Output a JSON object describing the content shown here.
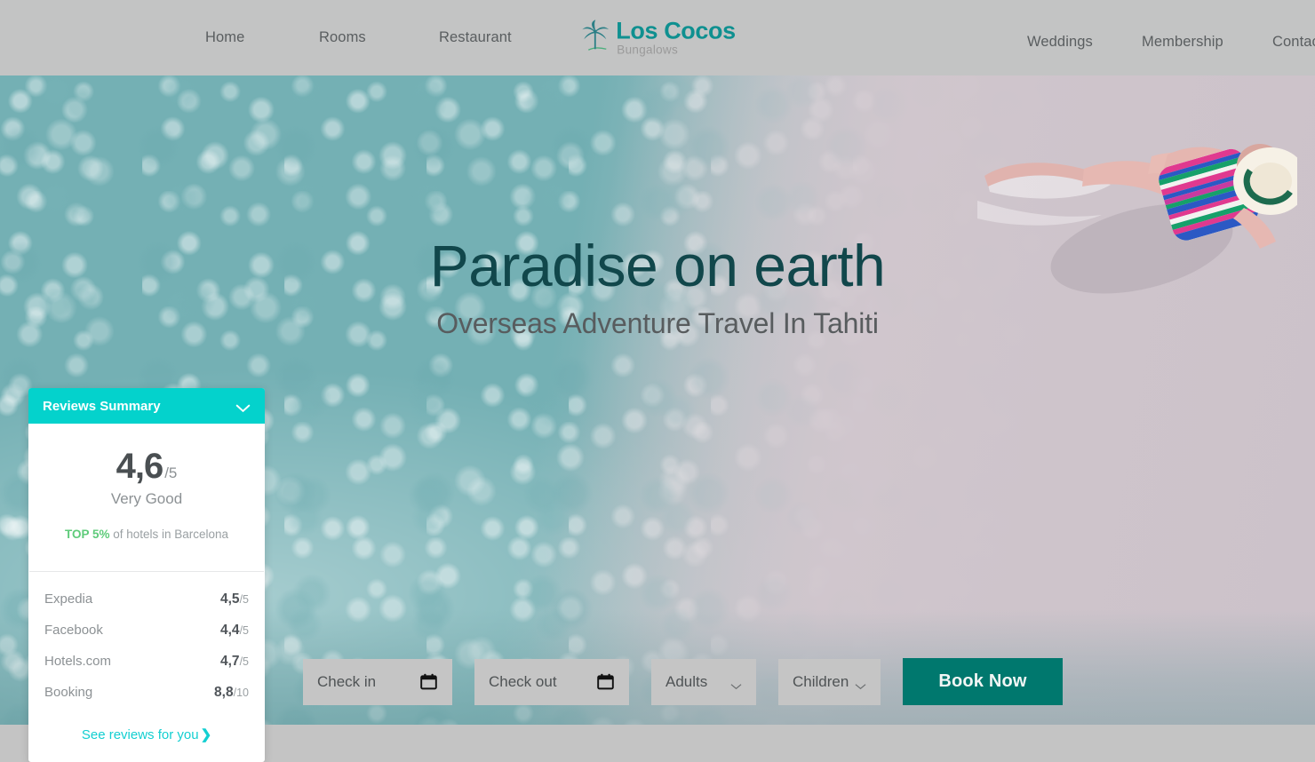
{
  "header": {
    "logo": {
      "name": "Los Cocos",
      "sub": "Bungalows",
      "icon": "palm-tree-icon"
    },
    "nav_left": [
      {
        "label": "Home"
      },
      {
        "label": "Rooms"
      },
      {
        "label": "Restaurant"
      }
    ],
    "nav_right": [
      {
        "label": "Weddings"
      },
      {
        "label": "Membership"
      },
      {
        "label": "Contact"
      }
    ]
  },
  "hero": {
    "title": "Paradise on earth",
    "subtitle": "Overseas Adventure Travel In Tahiti"
  },
  "booking": {
    "checkin": {
      "label": "Check in",
      "icon": "calendar-icon"
    },
    "checkout": {
      "label": "Check out",
      "icon": "calendar-icon"
    },
    "adults": {
      "label": "Adults",
      "icon": "chevron-down-icon"
    },
    "children": {
      "label": "Children",
      "icon": "chevron-down-icon"
    },
    "book_now": "Book Now"
  },
  "reviews": {
    "title": "Reviews Summary",
    "collapse_icon": "chevron-down-icon",
    "score": "4,6",
    "score_denominator": "/5",
    "score_label": "Very Good",
    "top_badge": "TOP 5%",
    "top_text": " of hotels in Barcelona",
    "sources": [
      {
        "name": "Expedia",
        "value": "4,5",
        "denominator": "/5"
      },
      {
        "name": "Facebook",
        "value": "4,4",
        "denominator": "/5"
      },
      {
        "name": "Hotels.com",
        "value": "4,7",
        "denominator": "/5"
      },
      {
        "name": "Booking",
        "value": "8,8",
        "denominator": "/10"
      }
    ],
    "link": "See reviews for you",
    "link_arrow": "❯"
  },
  "colors": {
    "brand_turquoise": "#04d2cc",
    "brand_teal": "#00786e",
    "logo_teal": "#0f9090",
    "headline_teal": "#11474b",
    "top_green": "#5ecb7a",
    "link_cyan": "#13cfd1",
    "header_gray": "#c3c4c4",
    "field_gray": "#c5c5c5"
  }
}
